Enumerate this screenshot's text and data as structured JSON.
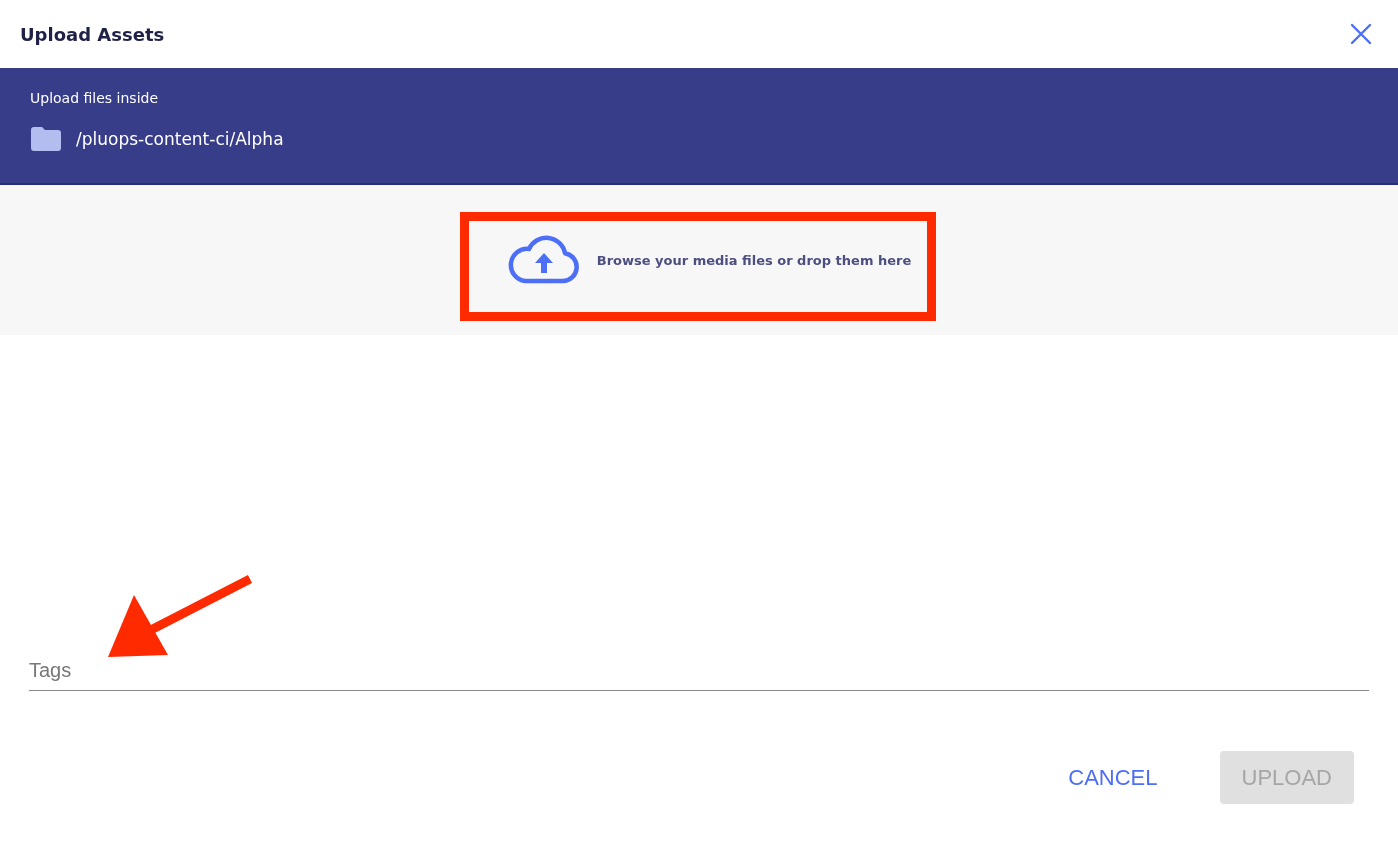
{
  "dialog": {
    "title": "Upload Assets"
  },
  "destination": {
    "label": "Upload files inside",
    "path": "/pluops-content-ci/Alpha"
  },
  "dropzone": {
    "text": "Browse your media files or drop them here"
  },
  "tags_field": {
    "placeholder": "Tags"
  },
  "buttons": [
    {
      "label": "CANCEL",
      "kind": "text",
      "disabled": false
    },
    {
      "label": "UPLOAD",
      "kind": "filled",
      "disabled": true
    }
  ]
}
